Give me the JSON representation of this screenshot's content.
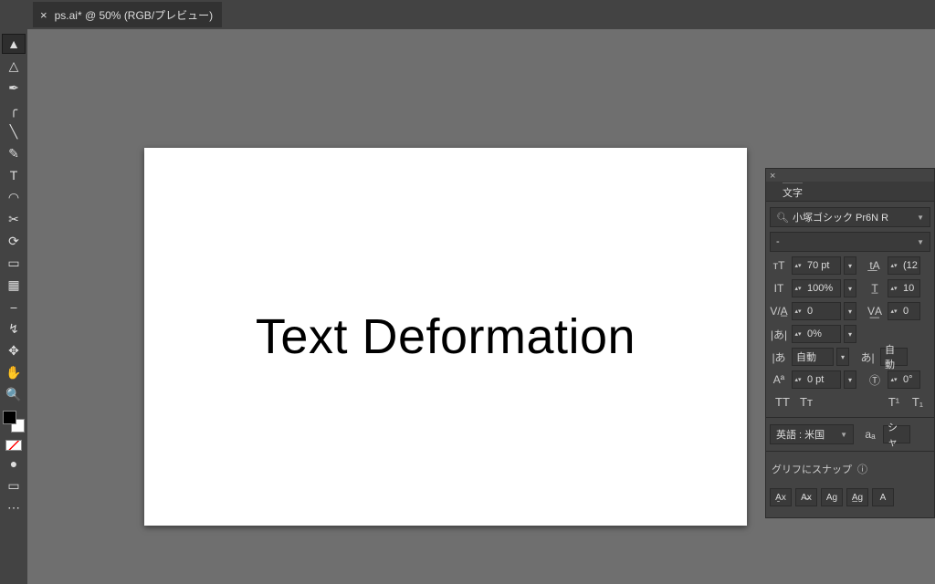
{
  "tab": {
    "close": "×",
    "title": "ps.ai* @ 50% (RGB/プレビュー)"
  },
  "canvas": {
    "text": "Text Deformation"
  },
  "panel": {
    "close": "×",
    "title": "文字",
    "font_name": "小塚ゴシック Pr6N R",
    "font_style": "-",
    "size": "70 pt",
    "leading_partial": "(12",
    "hscale": "100%",
    "vscale_partial": "10",
    "kerning": "0",
    "tracking": "0",
    "tsume": "0%",
    "aki_l": "自動",
    "aki_r": "自動",
    "baseline": "0 pt",
    "rotation": "0°",
    "styles": {
      "allcaps": "TT",
      "smallcaps": "Tт",
      "sup": "T¹",
      "sub": "T₁"
    },
    "lang": "英語 : 米国",
    "antialias": "シャ",
    "antialias_prefix": "aₐ",
    "snap_label": "グリフにスナップ",
    "info": "ⓘ",
    "snap": {
      "b1": "A̱x",
      "b2": "A̶x",
      "b3": "Ag",
      "b4": "A̲g",
      "b5": "A"
    }
  },
  "tools": {
    "selection": "▲",
    "direct": "△",
    "pen": "✒",
    "curv": "╭",
    "line": "╲",
    "brush": "✎",
    "type": "T",
    "shape": "◠",
    "scissors": "✂",
    "rotate": "⟳",
    "scale": "▭",
    "grad": "▦",
    "eyedrop": "⎯",
    "blend": "↯",
    "artb": "✥",
    "hand": "✋",
    "zoom": "🔍",
    "fill": "●",
    "ellipsis": "⋯"
  }
}
